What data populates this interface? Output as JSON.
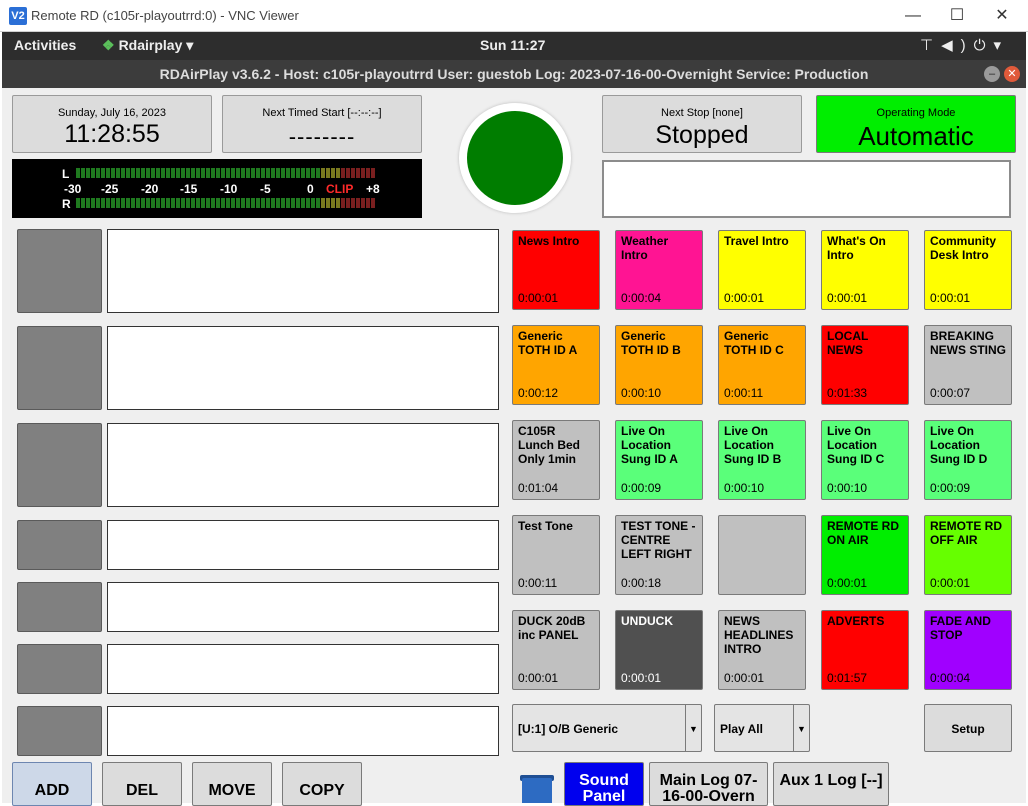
{
  "window": {
    "icon_text": "V2",
    "title": "Remote RD (c105r-playoutrrd:0) - VNC Viewer",
    "minimize": "—",
    "maximize": "☐",
    "close": "✕"
  },
  "gnome": {
    "activities": "Activities",
    "app_name": "Rdairplay",
    "app_menu_arrow": "▾",
    "clock": "Sun 11:27",
    "tray_icons": [
      "network-icon",
      "volume-icon",
      "power-icon",
      "chevron-down-icon"
    ]
  },
  "app": {
    "title": "RDAirPlay v3.6.2 - Host: c105r-playoutrrd User: guestob Log: 2023-07-16-00-Overnight Service: Production"
  },
  "clock_panel": {
    "date": "Sunday, July 16, 2023",
    "time": "11:28:55"
  },
  "timed_panel": {
    "label": "Next Timed Start [--:--:--]",
    "value": "--------"
  },
  "meter": {
    "left_label": "L",
    "right_label": "R",
    "scale": [
      "-30",
      "-25",
      "-20",
      "-15",
      "-10",
      "-5",
      "0",
      "CLIP",
      "+8"
    ],
    "colors": {
      "green": "#1f7a1f",
      "yellow": "#7a7a1f",
      "red": "#7a1f1f",
      "clip": "#ff2a2a"
    }
  },
  "on_air": {
    "color": "#007d00"
  },
  "next_stop": {
    "label": "Next Stop [none]",
    "value": "Stopped"
  },
  "operating_mode": {
    "label": "Operating Mode",
    "value": "Automatic",
    "color": "#00ee00"
  },
  "carts": [
    {
      "label": "News Intro",
      "length": "0:00:01",
      "color": "#ff0000"
    },
    {
      "label": "Weather Intro",
      "length": "0:00:04",
      "color": "#ff1493"
    },
    {
      "label": "Travel Intro",
      "length": "0:00:01",
      "color": "#ffff00"
    },
    {
      "label": "What's On Intro",
      "length": "0:00:01",
      "color": "#ffff00"
    },
    {
      "label": "Community Desk Intro",
      "length": "0:00:01",
      "color": "#ffff00"
    },
    {
      "label": "Generic TOTH ID A",
      "length": "0:00:12",
      "color": "#ffa500"
    },
    {
      "label": "Generic TOTH ID B",
      "length": "0:00:10",
      "color": "#ffa500"
    },
    {
      "label": "Generic TOTH ID C",
      "length": "0:00:11",
      "color": "#ffa500"
    },
    {
      "label": "LOCAL NEWS",
      "length": "0:01:33",
      "color": "#ff0000"
    },
    {
      "label": "BREAKING NEWS STING",
      "length": "0:00:07",
      "color": "#c0c0c0"
    },
    {
      "label": "C105R Lunch Bed Only 1min",
      "length": "0:01:04",
      "color": "#c0c0c0"
    },
    {
      "label": "Live On Location Sung ID A",
      "length": "0:00:09",
      "color": "#5aff7a"
    },
    {
      "label": "Live On Location Sung ID B",
      "length": "0:00:10",
      "color": "#5aff7a"
    },
    {
      "label": "Live On Location Sung ID C",
      "length": "0:00:10",
      "color": "#5aff7a"
    },
    {
      "label": "Live On Location Sung ID D",
      "length": "0:00:09",
      "color": "#5aff7a"
    },
    {
      "label": "Test Tone",
      "length": "0:00:11",
      "color": "#c0c0c0"
    },
    {
      "label": "TEST TONE - CENTRE LEFT RIGHT",
      "length": "0:00:18",
      "color": "#c0c0c0"
    },
    {
      "label": "",
      "length": "",
      "color": "#c0c0c0"
    },
    {
      "label": "REMOTE RD ON AIR",
      "length": "0:00:01",
      "color": "#00ee00"
    },
    {
      "label": "REMOTE RD OFF AIR",
      "length": "0:00:01",
      "color": "#66ff00"
    },
    {
      "label": "DUCK 20dB inc PANEL",
      "length": "0:00:01",
      "color": "#c0c0c0"
    },
    {
      "label": "UNDUCK",
      "length": "0:00:01",
      "color": "#505050",
      "text_color": "#ffffff"
    },
    {
      "label": "NEWS HEADLINES INTRO",
      "length": "0:00:01",
      "color": "#c0c0c0"
    },
    {
      "label": "ADVERTS",
      "length": "0:01:57",
      "color": "#ff0000"
    },
    {
      "label": "FADE AND STOP",
      "length": "0:00:04",
      "color": "#a000ff"
    }
  ],
  "panel_select": {
    "value": "[U:1] O/B Generic",
    "arrow": "▼"
  },
  "play_mode": {
    "value": "Play All",
    "arrow": "▼"
  },
  "setup": {
    "label": "Setup"
  },
  "actions": {
    "add": "ADD",
    "del": "DEL",
    "move": "MOVE",
    "copy": "COPY"
  },
  "log_buttons": {
    "sound_panel": "Sound Panel",
    "main_log": "Main Log 07-16-00-Overn",
    "aux1_log": "Aux 1 Log [--]"
  }
}
